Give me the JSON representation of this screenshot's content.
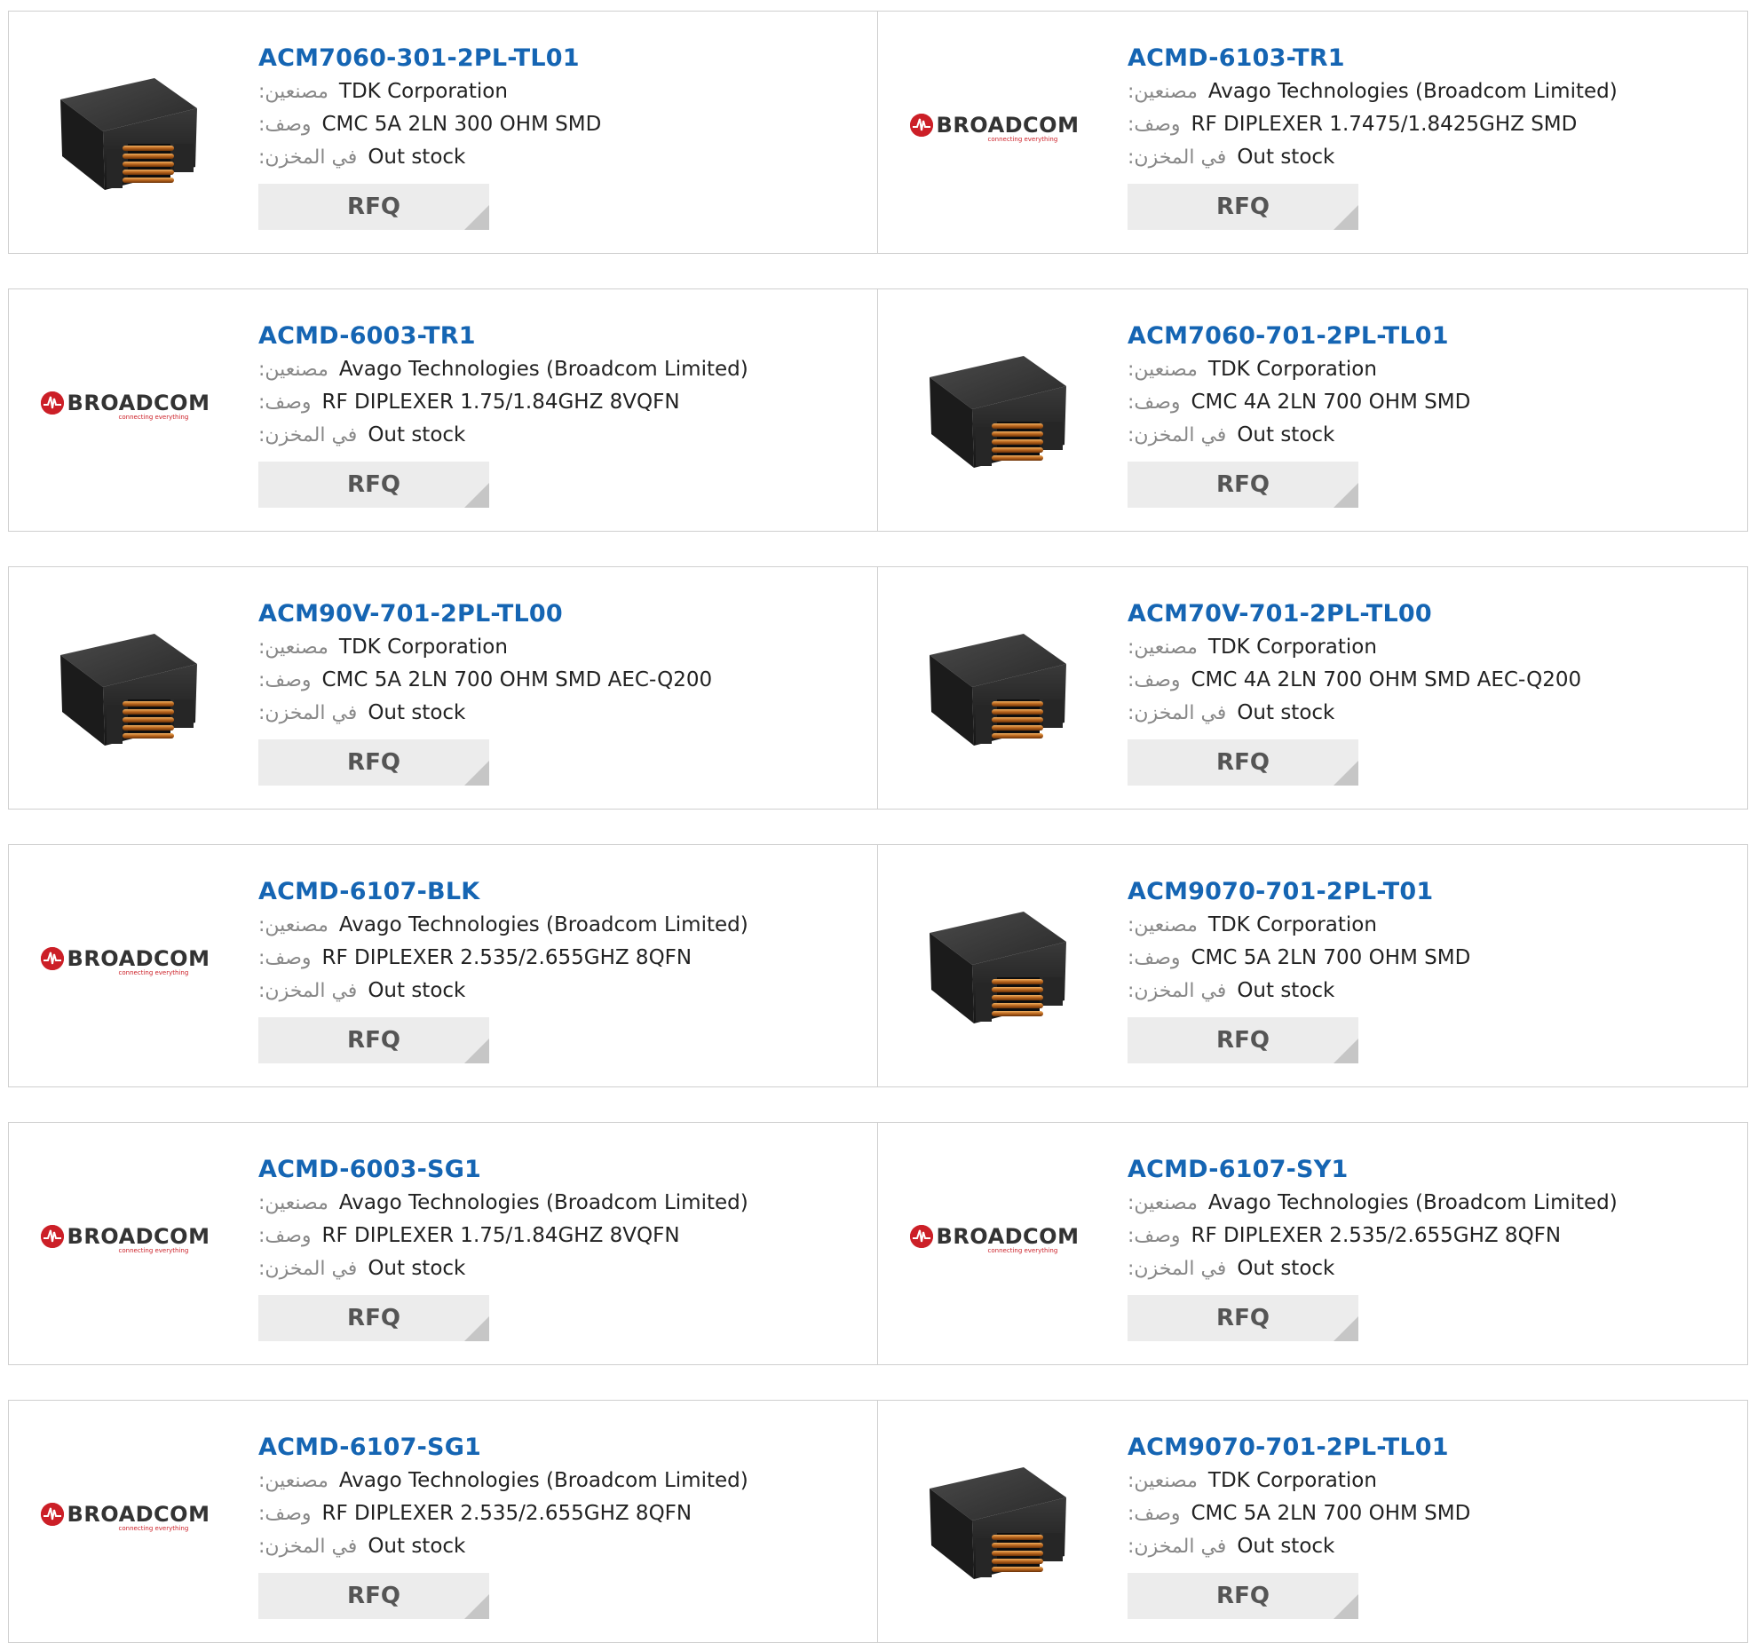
{
  "labels": {
    "manufacturer": ":مصنعين",
    "description": ":وصف",
    "stock": ":في المخزن"
  },
  "rfq_label": "RFQ",
  "logo": {
    "text": "BROADCOM",
    "tagline": "connecting everything"
  },
  "icons": {
    "inductor": "common-mode-choke-photo",
    "broadcom": "broadcom-logo"
  },
  "colors": {
    "link": "#1565b3",
    "rfq_bg": "#ececec",
    "logo_red": "#cc1f27"
  },
  "products": [
    {
      "part": "ACM7060-301-2PL-TL01",
      "manufacturer": "TDK Corporation",
      "description": "CMC 5A 2LN 300 OHM SMD",
      "stock": "Out stock",
      "image": "inductor"
    },
    {
      "part": "ACMD-6103-TR1",
      "manufacturer": "Avago Technologies (Broadcom Limited)",
      "description": "RF DIPLEXER 1.7475/1.8425GHZ SMD",
      "stock": "Out stock",
      "image": "broadcom"
    },
    {
      "part": "ACMD-6003-TR1",
      "manufacturer": "Avago Technologies (Broadcom Limited)",
      "description": "RF DIPLEXER 1.75/1.84GHZ 8VQFN",
      "stock": "Out stock",
      "image": "broadcom"
    },
    {
      "part": "ACM7060-701-2PL-TL01",
      "manufacturer": "TDK Corporation",
      "description": "CMC 4A 2LN 700 OHM SMD",
      "stock": "Out stock",
      "image": "inductor"
    },
    {
      "part": "ACM90V-701-2PL-TL00",
      "manufacturer": "TDK Corporation",
      "description": "CMC 5A 2LN 700 OHM SMD AEC-Q200",
      "stock": "Out stock",
      "image": "inductor"
    },
    {
      "part": "ACM70V-701-2PL-TL00",
      "manufacturer": "TDK Corporation",
      "description": "CMC 4A 2LN 700 OHM SMD AEC-Q200",
      "stock": "Out stock",
      "image": "inductor"
    },
    {
      "part": "ACMD-6107-BLK",
      "manufacturer": "Avago Technologies (Broadcom Limited)",
      "description": "RF DIPLEXER 2.535/2.655GHZ 8QFN",
      "stock": "Out stock",
      "image": "broadcom"
    },
    {
      "part": "ACM9070-701-2PL-T01",
      "manufacturer": "TDK Corporation",
      "description": "CMC 5A 2LN 700 OHM SMD",
      "stock": "Out stock",
      "image": "inductor"
    },
    {
      "part": "ACMD-6003-SG1",
      "manufacturer": "Avago Technologies (Broadcom Limited)",
      "description": "RF DIPLEXER 1.75/1.84GHZ 8VQFN",
      "stock": "Out stock",
      "image": "broadcom"
    },
    {
      "part": "ACMD-6107-SY1",
      "manufacturer": "Avago Technologies (Broadcom Limited)",
      "description": "RF DIPLEXER 2.535/2.655GHZ 8QFN",
      "stock": "Out stock",
      "image": "broadcom"
    },
    {
      "part": "ACMD-6107-SG1",
      "manufacturer": "Avago Technologies (Broadcom Limited)",
      "description": "RF DIPLEXER 2.535/2.655GHZ 8QFN",
      "stock": "Out stock",
      "image": "broadcom"
    },
    {
      "part": "ACM9070-701-2PL-TL01",
      "manufacturer": "TDK Corporation",
      "description": "CMC 5A 2LN 700 OHM SMD",
      "stock": "Out stock",
      "image": "inductor"
    }
  ]
}
